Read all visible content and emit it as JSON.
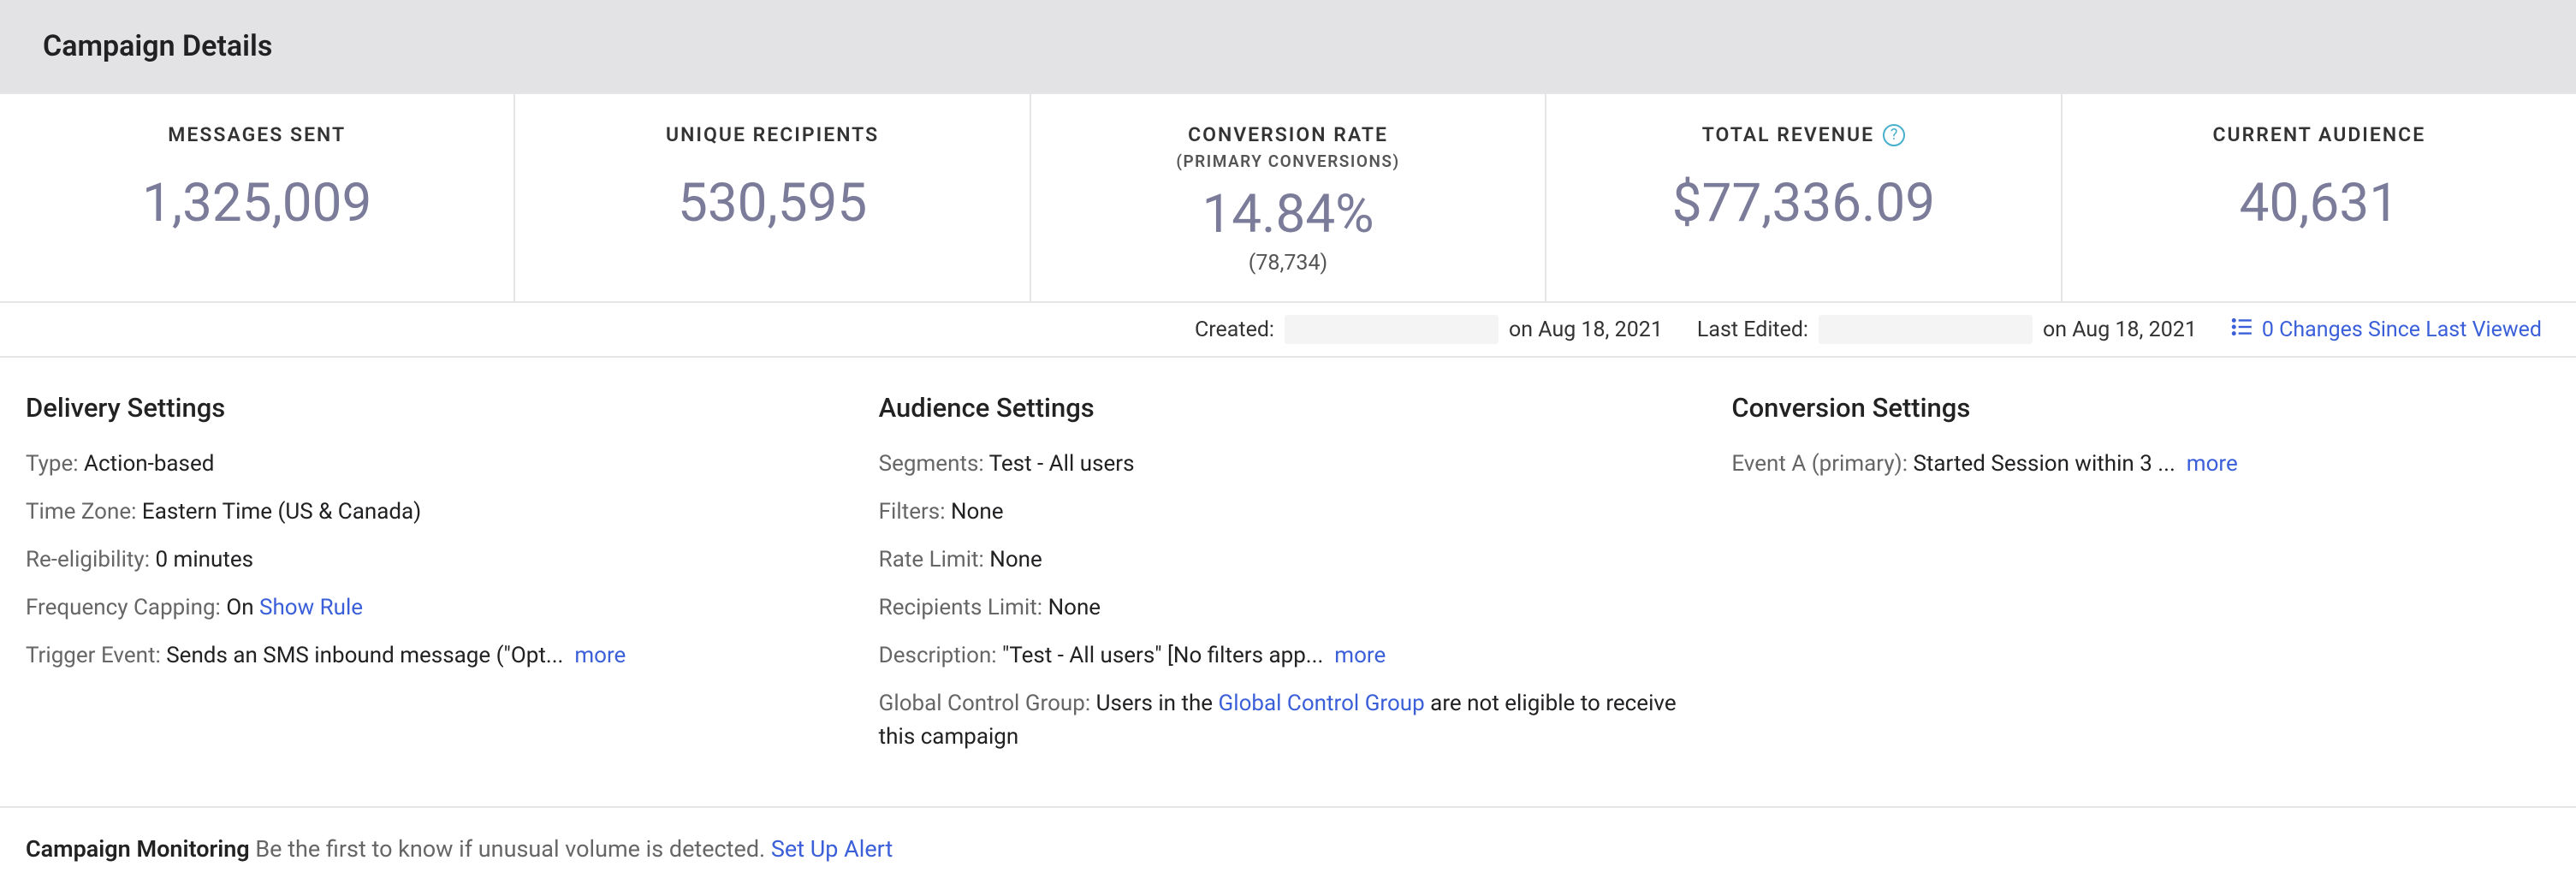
{
  "page_title": "Campaign Details",
  "stats": {
    "messages_sent": {
      "label": "MESSAGES SENT",
      "value": "1,325,009"
    },
    "unique_recipients": {
      "label": "UNIQUE RECIPIENTS",
      "value": "530,595"
    },
    "conversion_rate": {
      "label": "CONVERSION RATE",
      "sublabel": "(PRIMARY CONVERSIONS)",
      "value": "14.84%",
      "subvalue": "(78,734)"
    },
    "total_revenue": {
      "label": "TOTAL REVENUE",
      "value": "$77,336.09"
    },
    "current_audience": {
      "label": "CURRENT AUDIENCE",
      "value": "40,631"
    }
  },
  "meta": {
    "created_label": "Created:",
    "created_value": "on Aug 18, 2021",
    "edited_label": "Last Edited:",
    "edited_value": "on Aug 18, 2021",
    "changes_text": "0 Changes Since Last Viewed"
  },
  "delivery": {
    "title": "Delivery Settings",
    "type_label": "Type:",
    "type_value": "Action-based",
    "tz_label": "Time Zone:",
    "tz_value": "Eastern Time (US & Canada)",
    "reelig_label": "Re-eligibility:",
    "reelig_value": "0 minutes",
    "freq_label": "Frequency Capping:",
    "freq_value": "On",
    "freq_link": "Show Rule",
    "trigger_label": "Trigger Event:",
    "trigger_value": "Sends an SMS inbound message (\"Opt...",
    "more": "more"
  },
  "audience": {
    "title": "Audience Settings",
    "seg_label": "Segments:",
    "seg_value": "Test - All users",
    "filters_label": "Filters:",
    "filters_value": "None",
    "rate_label": "Rate Limit:",
    "rate_value": "None",
    "recip_label": "Recipients Limit:",
    "recip_value": "None",
    "desc_label": "Description:",
    "desc_value": "\"Test - All users\" [No filters app...",
    "more": "more",
    "gcg_label": "Global Control Group:",
    "gcg_prefix": "Users in the ",
    "gcg_link": "Global Control Group",
    "gcg_suffix": " are not eligible to receive this campaign"
  },
  "conversion": {
    "title": "Conversion Settings",
    "event_label": "Event A (primary):",
    "event_value": "Started Session within 3 ...",
    "more": "more"
  },
  "monitoring": {
    "title": "Campaign Monitoring",
    "text": "Be the first to know if unusual volume is detected.",
    "link": "Set Up Alert"
  }
}
